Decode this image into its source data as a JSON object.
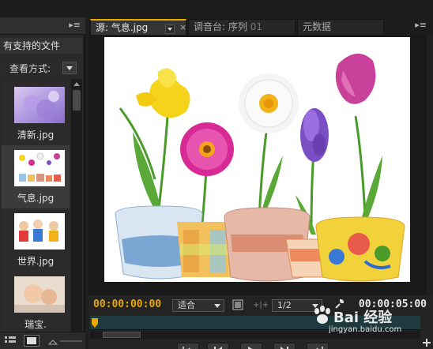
{
  "project_panel": {
    "title": "有支持的文件",
    "view_label": "查看方式:",
    "items": [
      {
        "label": "清新.jpg",
        "selected": false
      },
      {
        "label": "气息.jpg",
        "selected": true
      },
      {
        "label": "世界.jpg",
        "selected": false
      },
      {
        "label": "瑞宝.",
        "selected": false
      }
    ]
  },
  "monitor": {
    "tabs": [
      {
        "label": "源: 气息.jpg",
        "active": true
      },
      {
        "label": "调音台: 序列",
        "suffix": "01",
        "active": false
      },
      {
        "label": "元数据",
        "active": false
      }
    ],
    "current_time": "00:00:00:00",
    "fit_value": "适合",
    "resolution_value": "1/2",
    "duration": "00:00:05:00"
  },
  "watermark": {
    "brand": "Bai 经验",
    "url": "jingyan.baidu.com"
  },
  "colors": {
    "accent": "#e8a800",
    "panel_bg": "#282828",
    "timeline_bg": "#1f3a3f"
  }
}
